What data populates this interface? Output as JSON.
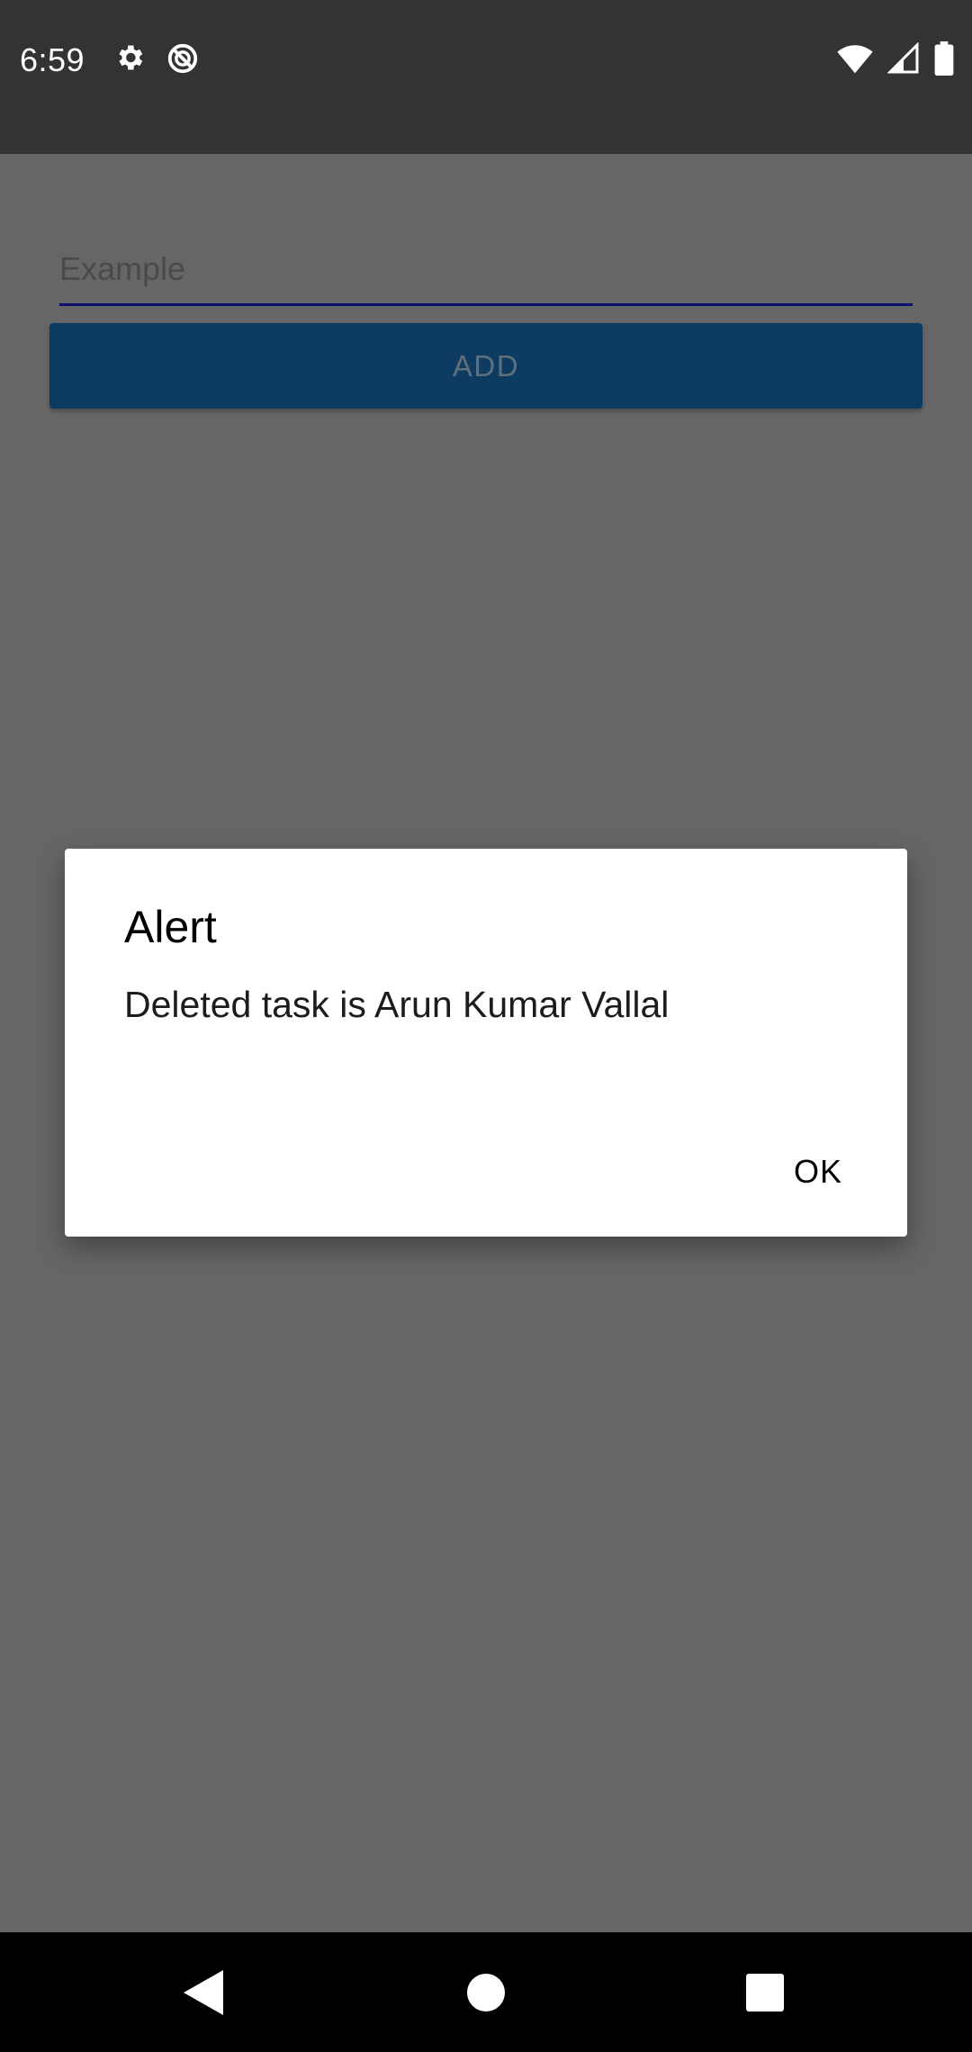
{
  "status_bar": {
    "time": "6:59",
    "left_icons": [
      "gear-icon",
      "do-not-disturb-icon"
    ],
    "right_icons": [
      "wifi-icon",
      "cell-signal-icon",
      "battery-icon"
    ]
  },
  "form": {
    "input_placeholder": "Example",
    "input_value": "",
    "add_button_label": "ADD"
  },
  "dialog": {
    "title": "Alert",
    "message": "Deleted task is Arun Kumar Vallal",
    "ok_label": "OK"
  },
  "nav_bar": {
    "buttons": [
      "back-icon",
      "home-icon",
      "recents-icon"
    ]
  },
  "colors": {
    "status_bar": "#333333",
    "scrim_background": "#666666",
    "add_button": "#0d3b61",
    "input_underline": "#0b0f6e",
    "dialog_background": "#ffffff",
    "nav_bar": "#000000"
  }
}
